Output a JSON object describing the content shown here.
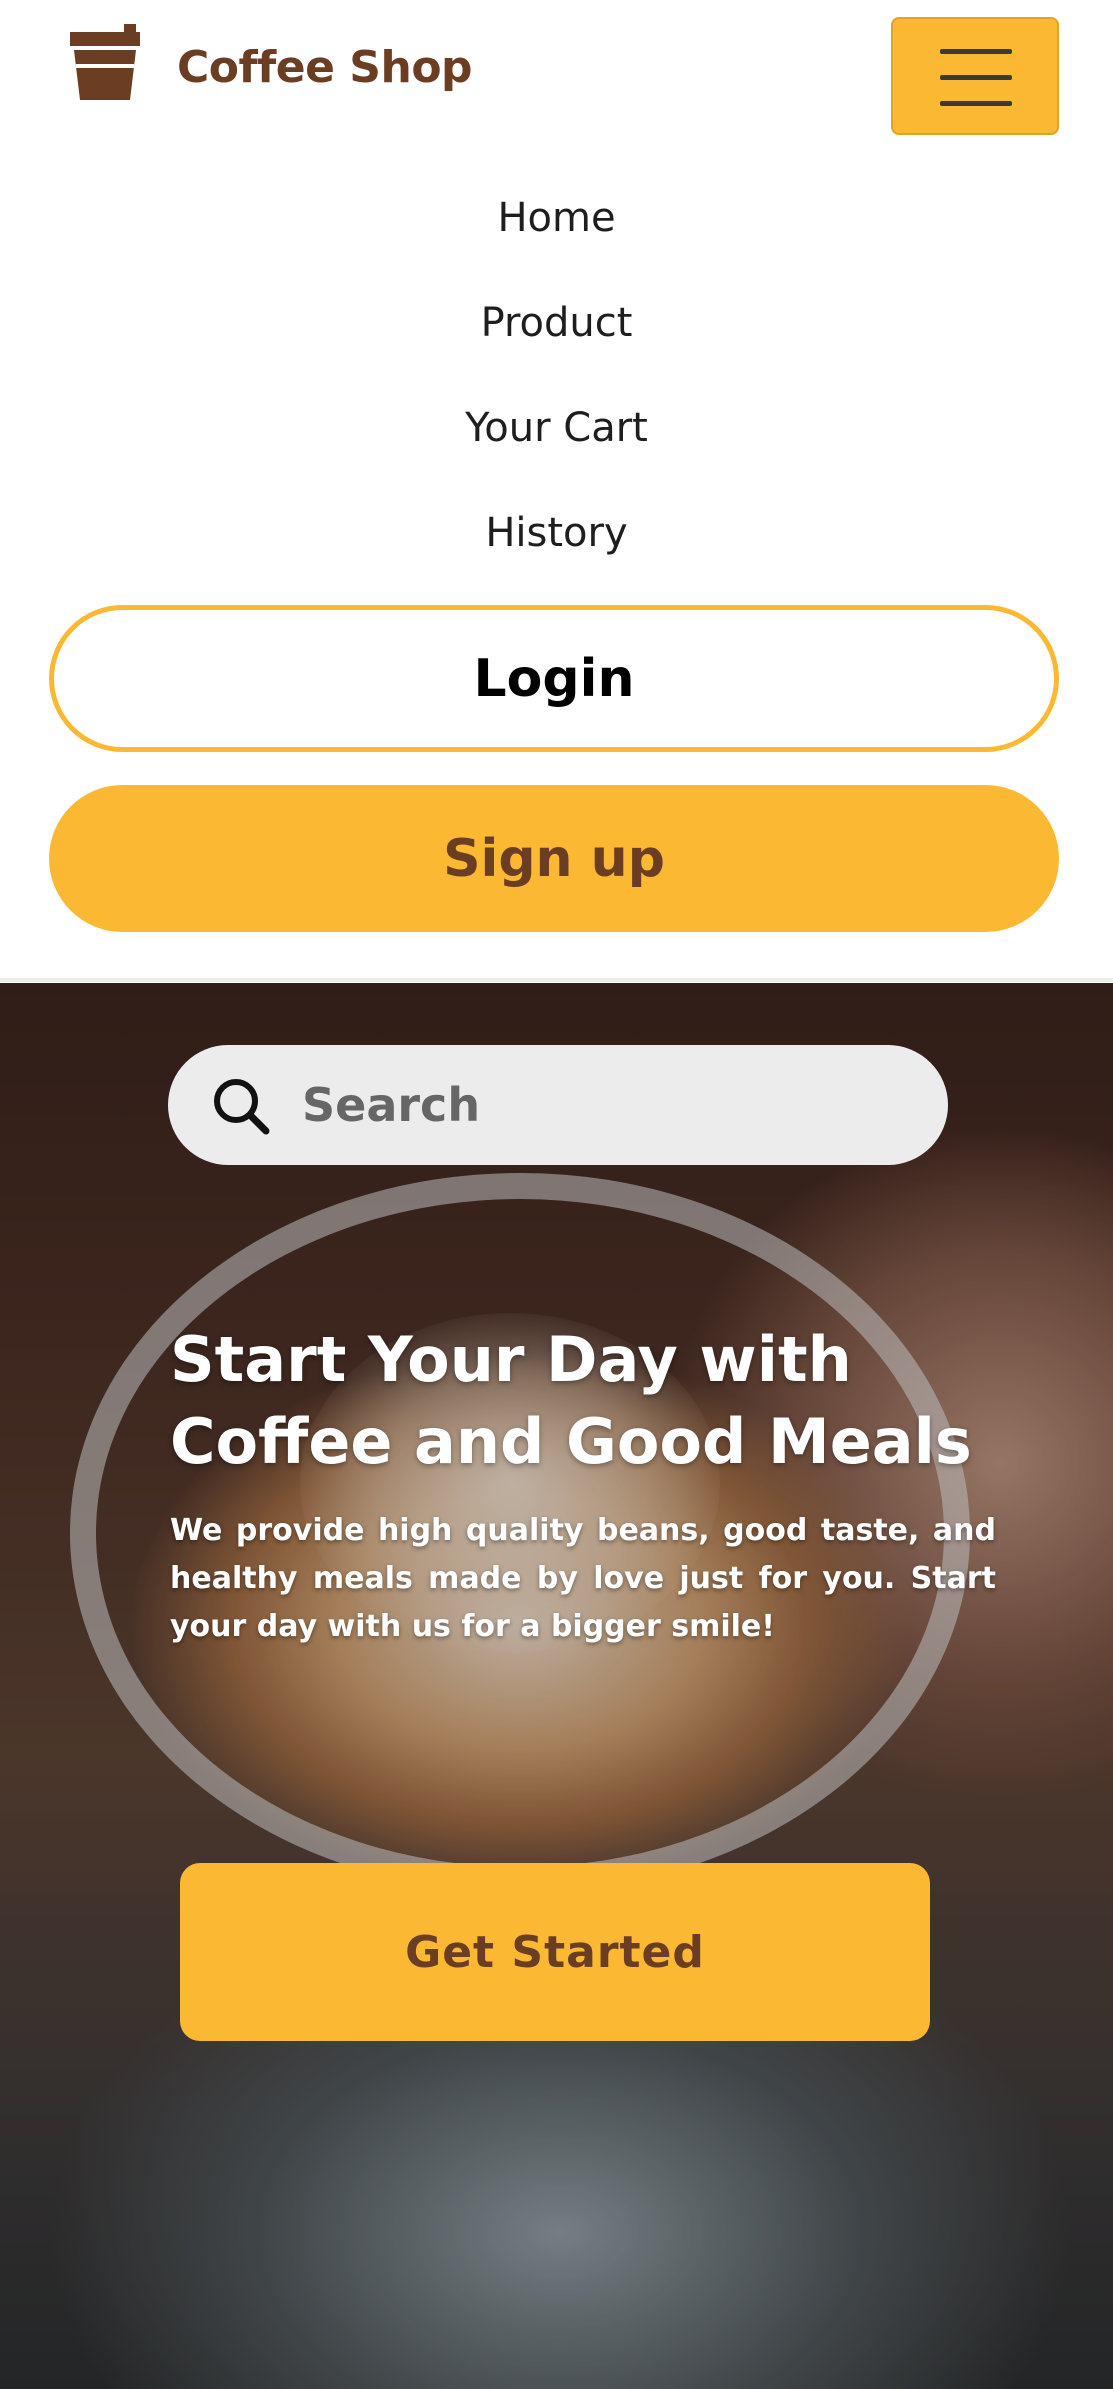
{
  "header": {
    "brand": "Coffee Shop",
    "logo_icon": "coffee-cup-icon",
    "menu_icon": "hamburger-menu-icon"
  },
  "menu": {
    "items": [
      {
        "label": "Home"
      },
      {
        "label": "Product"
      },
      {
        "label": "Your Cart"
      },
      {
        "label": "History"
      }
    ],
    "login_label": "Login",
    "signup_label": "Sign up"
  },
  "hero": {
    "search": {
      "placeholder": "Search",
      "value": "",
      "icon": "search-icon"
    },
    "title": "Start Your Day with Coffee and Good Meals",
    "description": "We provide high quality beans, good taste, and healthy meals made by love just for you. Start your day with us for a bigger smile!",
    "cta_label": "Get Started"
  },
  "colors": {
    "accent": "#fbb833",
    "brand_brown": "#6b3e24",
    "text_dark": "#1e1e1e"
  }
}
